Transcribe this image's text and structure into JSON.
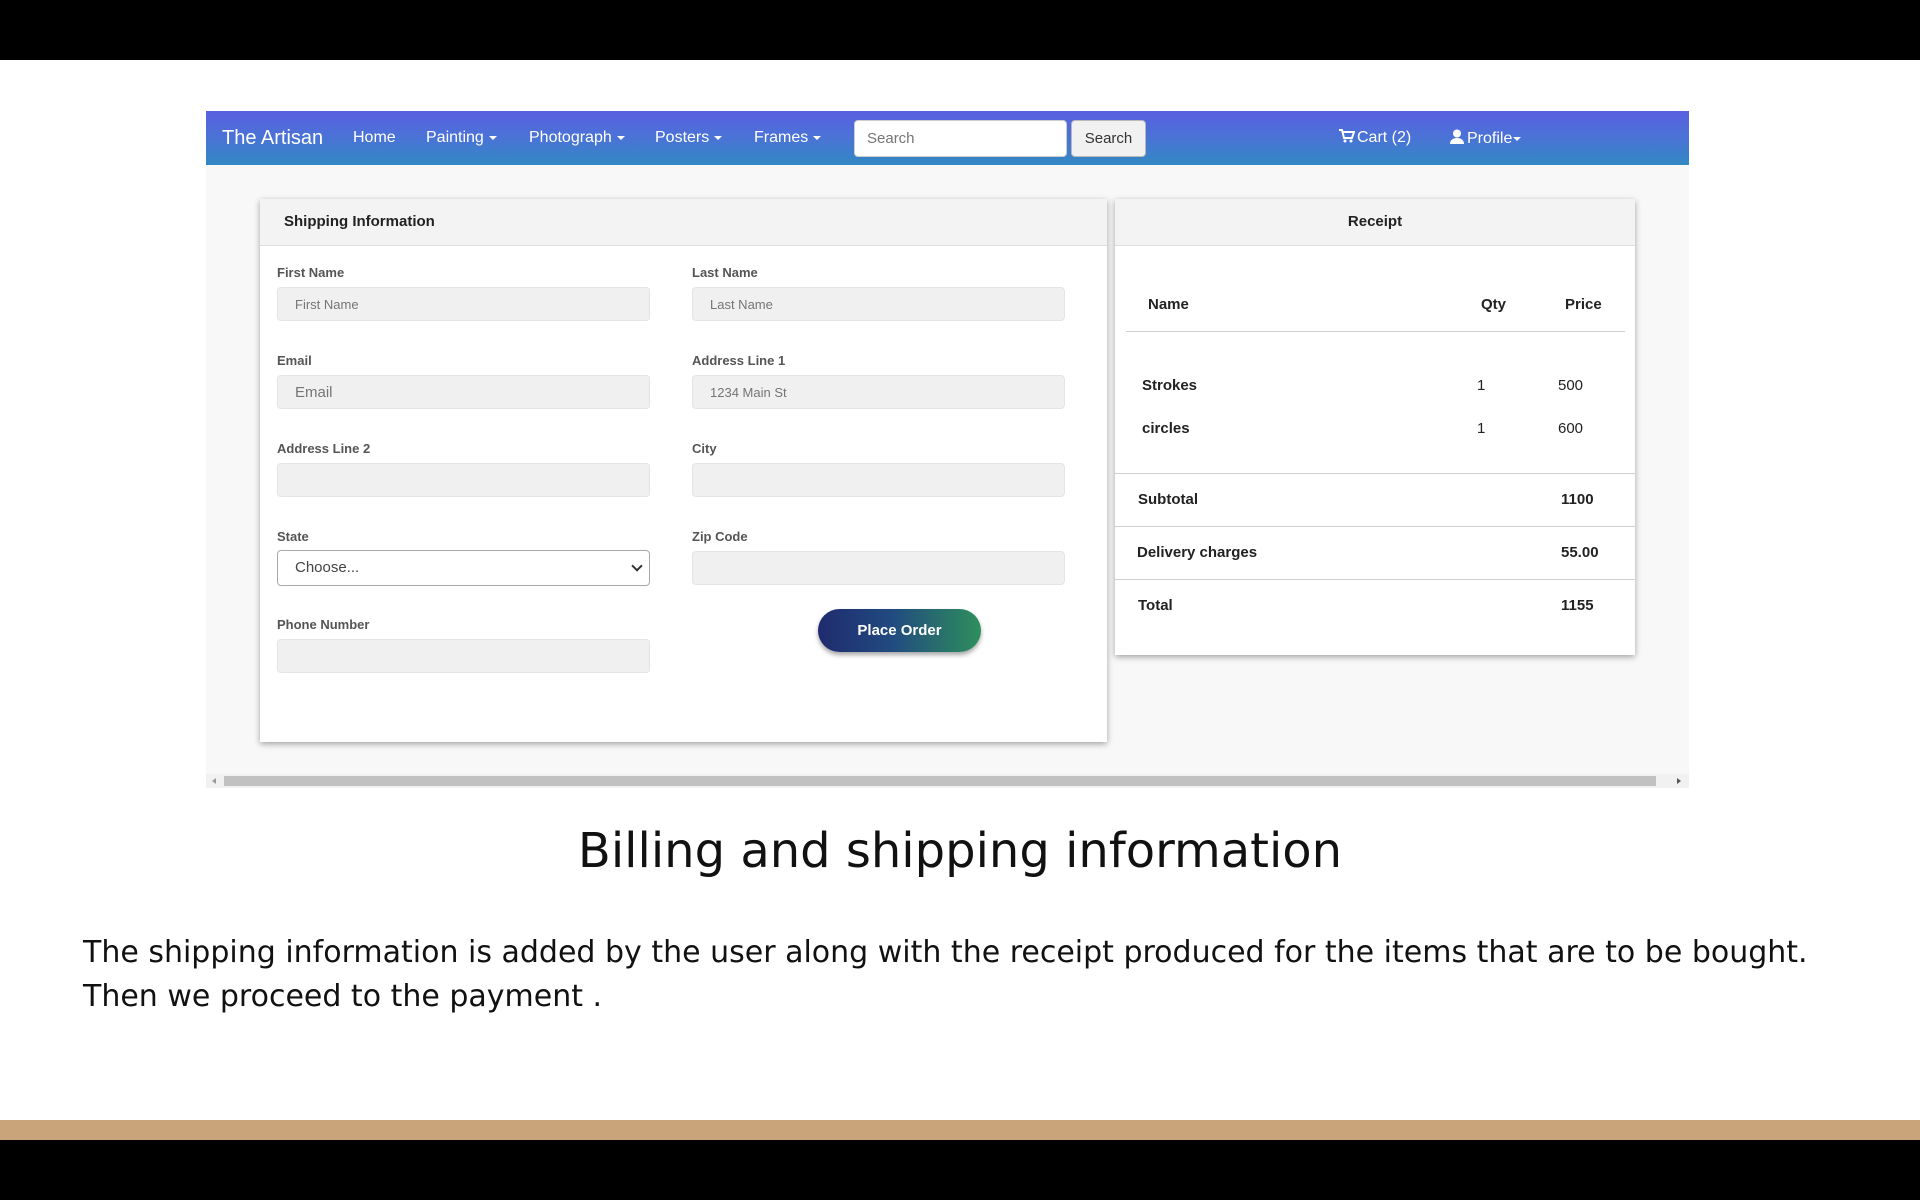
{
  "navbar": {
    "brand": "The Artisan",
    "items": [
      {
        "label": "Home",
        "dropdown": false
      },
      {
        "label": "Painting",
        "dropdown": true
      },
      {
        "label": "Photograph",
        "dropdown": true
      },
      {
        "label": "Posters",
        "dropdown": true
      },
      {
        "label": "Frames",
        "dropdown": true
      }
    ],
    "search_placeholder": "Search",
    "search_button": "Search",
    "cart_label": "Cart (2)",
    "profile_label": "Profile",
    "gradient_colors": [
      "#5a5fe0",
      "#3288c2"
    ]
  },
  "shipping": {
    "title": "Shipping Information",
    "fields": {
      "first_name": {
        "label": "First Name",
        "placeholder": "First Name"
      },
      "last_name": {
        "label": "Last Name",
        "placeholder": "Last Name"
      },
      "email": {
        "label": "Email",
        "placeholder": "Email"
      },
      "address1": {
        "label": "Address Line 1",
        "placeholder": "1234 Main St"
      },
      "address2": {
        "label": "Address Line 2",
        "placeholder": ""
      },
      "city": {
        "label": "City",
        "placeholder": ""
      },
      "state": {
        "label": "State",
        "selected": "Choose..."
      },
      "zip": {
        "label": "Zip Code",
        "placeholder": ""
      },
      "phone": {
        "label": "Phone Number",
        "placeholder": ""
      }
    },
    "place_order": "Place Order"
  },
  "receipt": {
    "title": "Receipt",
    "columns": {
      "name": "Name",
      "qty": "Qty",
      "price": "Price"
    },
    "items": [
      {
        "name": "Strokes",
        "qty": "1",
        "price": "500"
      },
      {
        "name": "circles",
        "qty": "1",
        "price": "600"
      }
    ],
    "subtotal_label": "Subtotal",
    "subtotal_value": "1100",
    "delivery_label": "Delivery charges",
    "delivery_value": "55.00",
    "total_label": "Total",
    "total_value": "1155"
  },
  "caption": {
    "title": "Billing and shipping information",
    "body": "The shipping information is added by the user along with the receipt produced for the items that are to be bought. Then we proceed to the payment ."
  },
  "colors": {
    "accent_bar": "#c9a47a",
    "place_order_gradient": [
      "#1f2b6e",
      "#2e8f5c"
    ]
  }
}
